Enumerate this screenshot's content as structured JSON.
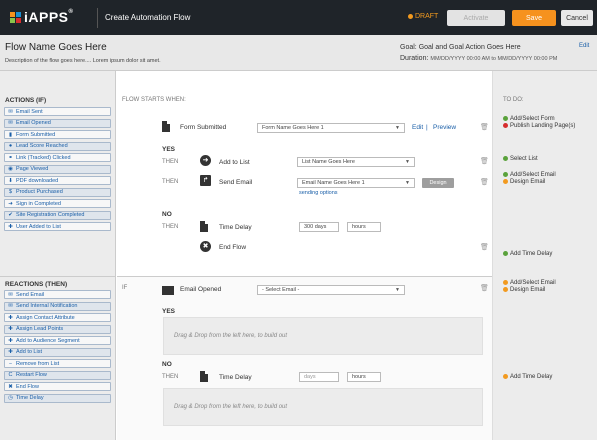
{
  "topbar": {
    "brand": "iAPPS",
    "brand_mark": "®",
    "logo_colors": [
      "#f6921e",
      "#1a8fd1",
      "#8bc34a",
      "#d62d2d"
    ],
    "page_title": "Create Automation Flow",
    "status": "DRAFT",
    "activate_label": "Activate",
    "save_label": "Save",
    "cancel_label": "Cancel"
  },
  "header": {
    "flow_name": "Flow Name Goes Here",
    "description": "Description of the flow goes here.... Lorem ipsum dolor sit amet.",
    "goal_label": "Goal:",
    "goal_value": "Goal and Goal Action Goes Here",
    "edit_label": "Edit",
    "duration_label": "Duration:",
    "duration_value": "MM/DD/YYYY 00:00 AM to MM/DD/YYYY 00:00 PM"
  },
  "sidebar": {
    "actions_title": "ACTIONS (IF)",
    "actions": [
      {
        "icon": "envelope-icon",
        "glyph": "✉",
        "label": "Email Sent"
      },
      {
        "icon": "envelope-open-icon",
        "glyph": "✉",
        "label": "Email Opened"
      },
      {
        "icon": "document-icon",
        "glyph": "▮",
        "label": "Form Submitted"
      },
      {
        "icon": "circle-icon",
        "glyph": "●",
        "label": "Lead Score Reached"
      },
      {
        "icon": "link-icon",
        "glyph": "⚭",
        "label": "Link (Tracked) Clicked"
      },
      {
        "icon": "eye-icon",
        "glyph": "◉",
        "label": "Page Viewed"
      },
      {
        "icon": "download-icon",
        "glyph": "⬇",
        "label": "PDF downloaded"
      },
      {
        "icon": "dollar-icon",
        "glyph": "$",
        "label": "Product Purchased"
      },
      {
        "icon": "sign-in-icon",
        "glyph": "➜",
        "label": "Sign in Completed"
      },
      {
        "icon": "check-icon",
        "glyph": "✔",
        "label": "Site Registration Completed"
      },
      {
        "icon": "plus-circle-icon",
        "glyph": "✚",
        "label": "User Added to List"
      }
    ],
    "reactions_title": "REACTIONS (THEN)",
    "reactions": [
      {
        "icon": "envelope-icon",
        "glyph": "✉",
        "label": "Send Email"
      },
      {
        "icon": "notification-icon",
        "glyph": "✉",
        "label": "Send Internal Notification"
      },
      {
        "icon": "plus-circle-icon",
        "glyph": "✚",
        "label": "Assign Contact Attribute"
      },
      {
        "icon": "plus-circle-icon",
        "glyph": "✚",
        "label": "Assign Lead Points"
      },
      {
        "icon": "plus-circle-icon",
        "glyph": "✚",
        "label": "Add to Audience Segment"
      },
      {
        "icon": "plus-circle-icon",
        "glyph": "✚",
        "label": "Add to List"
      },
      {
        "icon": "minus-circle-icon",
        "glyph": "−",
        "label": "Remove from List"
      },
      {
        "icon": "restart-icon",
        "glyph": "C",
        "label": "Restart Flow"
      },
      {
        "icon": "stop-icon",
        "glyph": "✖",
        "label": "End Flow"
      },
      {
        "icon": "clock-icon",
        "glyph": "◷",
        "label": "Time Delay"
      }
    ]
  },
  "main": {
    "flow_starts": "FLOW STARTS WHEN:",
    "trigger_label": "Form Submitted",
    "trigger_select": "Form Name Goes Here 1",
    "edit_link": "Edit",
    "divider": "|",
    "preview_link": "Preview",
    "yes": "YES",
    "then": "THEN",
    "add_to_list_label": "Add to List",
    "add_to_list_select": "List Name Goes Here",
    "send_email_label": "Send Email",
    "send_email_select": "Email Name Goes Here 1",
    "design_label": "Design",
    "sending_options": "sending options",
    "no": "NO",
    "time_delay_label": "Time Delay",
    "delay_value": "300 days",
    "delay_unit": "hours",
    "end_flow_label": "End Flow",
    "if": "IF",
    "email_opened_label": "Email Opened",
    "email_select": "- Select Email -",
    "dropzone_text": "Drag & Drop from the left here, to build out",
    "delay2_placeholder": "days",
    "delay2_unit": "hours"
  },
  "todo": {
    "title": "TO DO:",
    "items": [
      {
        "status": "ok",
        "text": "Add/Select Form"
      },
      {
        "status": "err",
        "text": "Publish Landing Page(s)"
      },
      {
        "status": "ok",
        "text": "Select List"
      },
      {
        "status": "ok",
        "text": "Add/Select Email"
      },
      {
        "status": "warn",
        "text": "Design Email"
      },
      {
        "status": "ok",
        "text": "Add Time Delay"
      },
      {
        "status": "warn",
        "text": "Add/Select Email"
      },
      {
        "status": "warn",
        "text": "Design Email"
      },
      {
        "status": "warn",
        "text": "Add Time Delay"
      }
    ]
  }
}
